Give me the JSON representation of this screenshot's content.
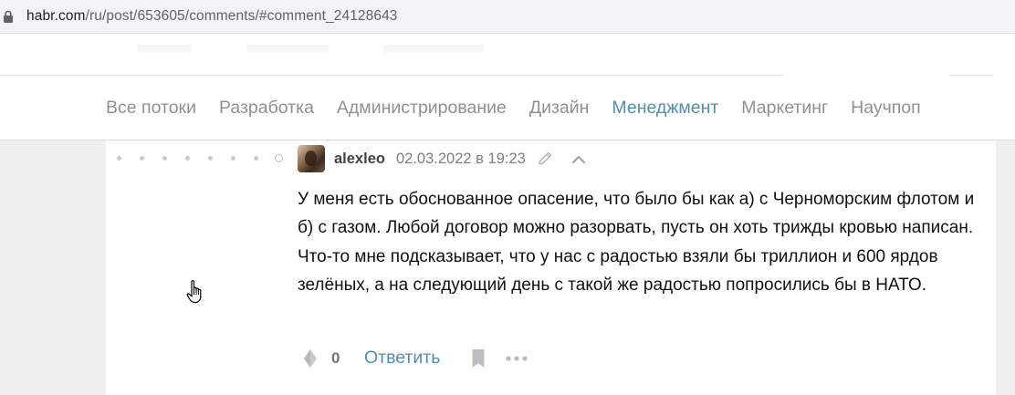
{
  "browser": {
    "url_host": "habr.com",
    "url_path": "/ru/post/653605/comments/#comment_24128643"
  },
  "hubs": [
    {
      "label": "Все потоки",
      "active": false
    },
    {
      "label": "Разработка",
      "active": false
    },
    {
      "label": "Администрирование",
      "active": false
    },
    {
      "label": "Дизайн",
      "active": false
    },
    {
      "label": "Менеджмент",
      "active": true
    },
    {
      "label": "Маркетинг",
      "active": false
    },
    {
      "label": "Научпоп",
      "active": false
    }
  ],
  "comment": {
    "author": "alexleo",
    "datetime": "02.03.2022 в 19:23",
    "text": "У меня есть обоснованное опасение, что было бы как а) с Черноморским флотом и б) с газом. Любой договор можно разорвать, пусть он хоть трижды кровью написан. Что-то мне подсказывает, что у нас с радостью взяли бы триллион и 600 ярдов зелёных, а на следующий день с такой же радостью попросились бы в НАТО.",
    "votes": "0",
    "reply_label": "Ответить"
  },
  "icons": {
    "lock": "lock-icon",
    "edit": "pencil-icon",
    "up": "chevron-up-icon",
    "vote": "diamond-vote-icon",
    "bookmark": "bookmark-icon",
    "more": "more-dots-icon",
    "cursor": "hand-cursor-icon"
  },
  "colors": {
    "accent": "#548eaa",
    "hub_text": "#8e9194",
    "comment_text": "#111111"
  }
}
